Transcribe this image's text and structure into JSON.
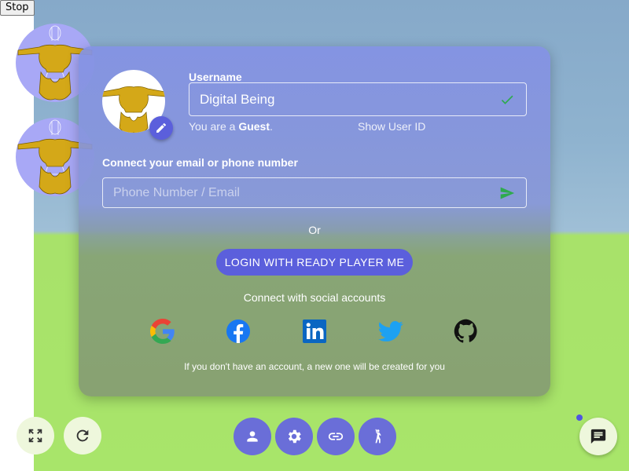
{
  "stop_label": "Stop",
  "login": {
    "username_label": "Username",
    "username_value": "Digital Being",
    "guest_prefix": "You are a ",
    "guest_word": "Guest",
    "guest_suffix": ".",
    "show_user_id": "Show User ID",
    "connect_label": "Connect your email or phone number",
    "contact_placeholder": "Phone Number / Email",
    "or_text": "Or",
    "rpm_button": "LOGIN WITH READY PLAYER ME",
    "social_text": "Connect with social accounts",
    "social_providers": [
      "google",
      "facebook",
      "linkedin",
      "twitter",
      "github"
    ],
    "note": "If you don't have an account, a new one will be created for you"
  },
  "colors": {
    "accent": "#5b5fdc",
    "confirm_green": "#2eaa4e",
    "ground": "#a8e56a",
    "sky": "#8fb3cf"
  },
  "icons": {
    "edit": "pencil-icon",
    "check": "check-icon",
    "send": "send-icon",
    "fullscreen": "fullscreen-icon",
    "refresh": "refresh-icon",
    "user": "person-icon",
    "settings": "gear-icon",
    "link": "link-icon",
    "emote": "dance-icon",
    "chat": "chat-icon"
  }
}
